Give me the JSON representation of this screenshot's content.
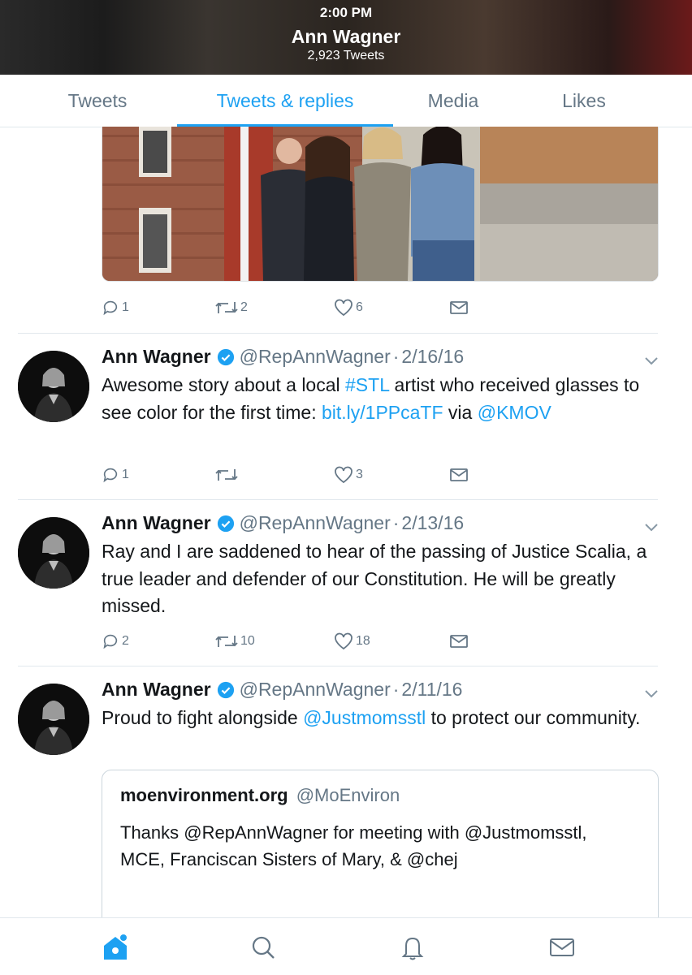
{
  "status_bar": {
    "time": "2:00 PM"
  },
  "header": {
    "name": "Ann Wagner",
    "tweet_count": "2,923 Tweets"
  },
  "tabs": [
    {
      "label": "Tweets",
      "active": false
    },
    {
      "label": "Tweets & replies",
      "active": true
    },
    {
      "label": "Media",
      "active": false
    },
    {
      "label": "Likes",
      "active": false
    }
  ],
  "top_tweet": {
    "photo": "photo-four-people-outside-building",
    "actions": {
      "replies": "1",
      "retweets": "2",
      "likes": "6"
    }
  },
  "tweets": [
    {
      "name": "Ann Wagner",
      "handle": "@RepAnnWagner",
      "separator": "·",
      "date": "2/16/16",
      "text_parts": {
        "a": "Awesome story about a local ",
        "b": "#STL",
        "c": " artist who received glasses to see color for the first time: ",
        "d": "bit.ly/1PPcaTF",
        "e": " via ",
        "f": "@KMOV"
      },
      "actions": {
        "replies": "1",
        "retweets": "",
        "likes": "3"
      }
    },
    {
      "name": "Ann Wagner",
      "handle": "@RepAnnWagner",
      "separator": "·",
      "date": "2/13/16",
      "text": "Ray and I are saddened to hear of the passing of Justice Scalia, a true leader and defender of our Constitution. He will be greatly missed.",
      "actions": {
        "replies": "2",
        "retweets": "10",
        "likes": "18"
      }
    },
    {
      "name": "Ann Wagner",
      "handle": "@RepAnnWagner",
      "separator": "·",
      "date": "2/11/16",
      "text_parts": {
        "a": "Proud to fight alongside ",
        "b": "@Justmomsstl",
        "c": " to protect our community."
      },
      "quote": {
        "name": "moenvironment.org",
        "handle": "@MoEnviron",
        "text": "Thanks @RepAnnWagner for meeting with @Justmomsstl, MCE, Franciscan Sisters of Mary, & @chej"
      }
    }
  ],
  "bottom_nav": [
    "home-icon",
    "search-icon",
    "notifications-bell-icon",
    "messages-envelope-icon"
  ],
  "colors": {
    "accent": "#1da1f2",
    "muted": "#657786",
    "text": "#14171a",
    "border": "#e1e8ed"
  }
}
